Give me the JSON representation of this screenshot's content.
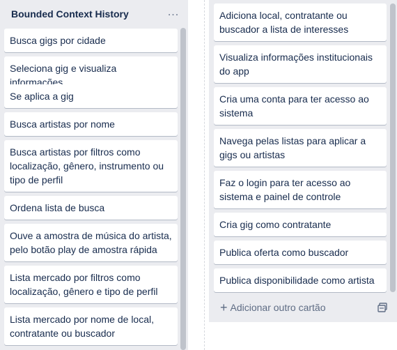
{
  "left_list": {
    "title": "Bounded Context History",
    "menu_glyph": "...",
    "cards": [
      "Busca gigs por cidade",
      "Seleciona gig e visualiza informações",
      "Se aplica a gig",
      "Busca artistas por nome",
      "Busca artistas por filtros como localização, gênero, instrumento ou tipo de perfil",
      "Ordena lista de busca",
      "Ouve a amostra de música do artista, pelo botão play de amostra rápida",
      "Lista mercado por filtros como localização, gênero e tipo de perfil",
      "Lista mercado por nome de local, contratante ou buscador"
    ]
  },
  "right_list": {
    "cards": [
      "Adiciona local, contratante ou buscador a lista de interesses",
      "Visualiza informações institucionais do app",
      "Cria uma conta para ter acesso ao sistema",
      "Navega pelas listas para aplicar a gigs ou artistas",
      "Faz o login para ter acesso ao sistema e painel de controle",
      "Cria gig como contratante",
      "Publica oferta como buscador",
      "Publica disponibilidade como artista"
    ],
    "add_card_label": "Adicionar outro cartão",
    "add_card_glyph": "+"
  },
  "colors": {
    "list_bg": "#ebecf0",
    "card_bg": "#ffffff",
    "text": "#172b4d",
    "muted": "#5e6c84"
  },
  "icons": [
    "more-icon",
    "plus-icon",
    "template-icon"
  ]
}
